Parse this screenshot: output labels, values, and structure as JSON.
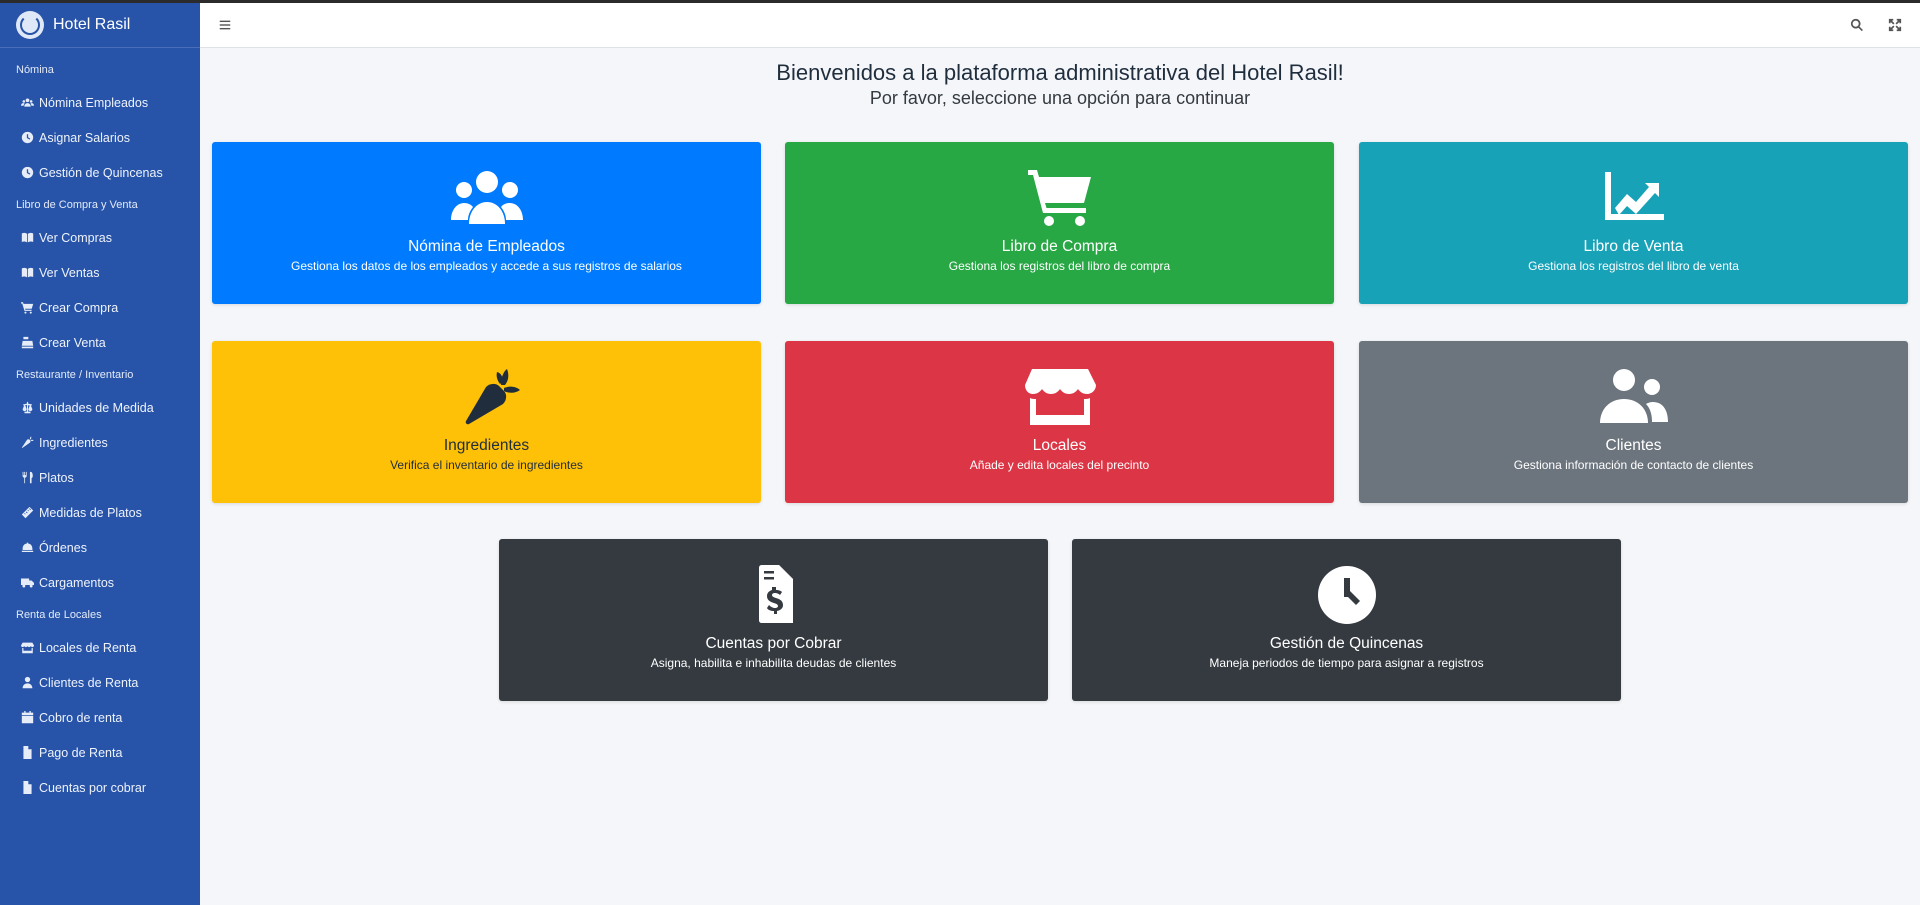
{
  "brand": {
    "name": "Hotel Rasil"
  },
  "sidebar": {
    "sections": [
      {
        "title": "Nómina",
        "items": [
          {
            "label": "Nómina Empleados",
            "icon": "users-icon"
          },
          {
            "label": "Asignar Salarios",
            "icon": "clock-icon"
          },
          {
            "label": "Gestión de Quincenas",
            "icon": "clock-icon"
          }
        ]
      },
      {
        "title": "Libro de Compra y Venta",
        "items": [
          {
            "label": "Ver Compras",
            "icon": "book-icon"
          },
          {
            "label": "Ver Ventas",
            "icon": "book-icon"
          },
          {
            "label": "Crear Compra",
            "icon": "cart-icon"
          },
          {
            "label": "Crear Venta",
            "icon": "cash-register-icon"
          }
        ]
      },
      {
        "title": "Restaurante / Inventario",
        "items": [
          {
            "label": "Unidades de Medida",
            "icon": "scale-icon"
          },
          {
            "label": "Ingredientes",
            "icon": "carrot-icon"
          },
          {
            "label": "Platos",
            "icon": "utensils-icon"
          },
          {
            "label": "Medidas de Platos",
            "icon": "ruler-icon"
          },
          {
            "label": "Órdenes",
            "icon": "bell-icon"
          },
          {
            "label": "Cargamentos",
            "icon": "truck-icon"
          }
        ]
      },
      {
        "title": "Renta de Locales",
        "items": [
          {
            "label": "Locales de Renta",
            "icon": "store-icon"
          },
          {
            "label": "Clientes de Renta",
            "icon": "user-icon"
          },
          {
            "label": "Cobro de renta",
            "icon": "calendar-icon"
          },
          {
            "label": "Pago de Renta",
            "icon": "file-icon"
          },
          {
            "label": "Cuentas por cobrar",
            "icon": "file-icon"
          }
        ]
      }
    ]
  },
  "main": {
    "welcome": "Bienvenidos a la plataforma administrativa del Hotel Rasil!",
    "subtitle": "Por favor, seleccione una opción para continuar",
    "cards": [
      {
        "title": "Nómina de Empleados",
        "desc": "Gestiona los datos de los empleados y accede a sus registros de salarios",
        "icon": "users-icon",
        "color": "#007bff"
      },
      {
        "title": "Libro de Compra",
        "desc": "Gestiona los registros del libro de compra",
        "icon": "cart-icon",
        "color": "#28a745"
      },
      {
        "title": "Libro de Venta",
        "desc": "Gestiona los registros del libro de venta",
        "icon": "chart-line-icon",
        "color": "#17a2b8"
      },
      {
        "title": "Ingredientes",
        "desc": "Verifica el inventario de ingredientes",
        "icon": "carrot-icon",
        "color": "#ffc107"
      },
      {
        "title": "Locales",
        "desc": "Añade y edita locales del precinto",
        "icon": "store-icon",
        "color": "#dc3545"
      },
      {
        "title": "Clientes",
        "desc": "Gestiona información de contacto de clientes",
        "icon": "user-friends-icon",
        "color": "#6c757d"
      },
      {
        "title": "Cuentas por Cobrar",
        "desc": "Asigna, habilita e inhabilita deudas de clientes",
        "icon": "invoice-dollar-icon",
        "color": "#343a40"
      },
      {
        "title": "Gestión de Quincenas",
        "desc": "Maneja periodos de tiempo para asignar a registros",
        "icon": "clock-icon",
        "color": "#343a40"
      }
    ]
  },
  "header": {
    "menu_icon": "hamburger-icon",
    "search_icon": "search-icon",
    "fullscreen_icon": "expand-icon"
  }
}
